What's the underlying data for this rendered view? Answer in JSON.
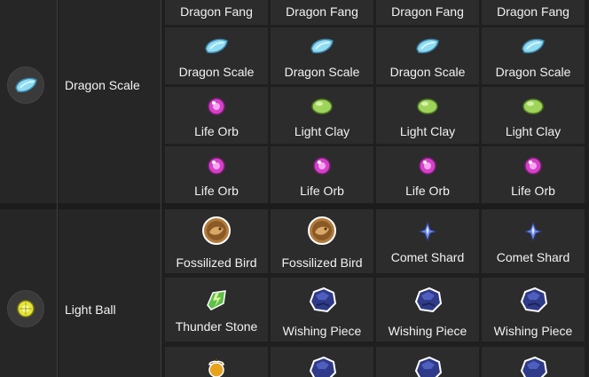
{
  "groups": [
    {
      "item": {
        "name": "Dragon Scale",
        "icon": "dragon-scale-icon"
      },
      "rows": [
        [
          "Dragon Fang",
          "Dragon Fang",
          "Dragon Fang",
          "Dragon Fang"
        ],
        [
          "Dragon Scale",
          "Dragon Scale",
          "Dragon Scale",
          "Dragon Scale"
        ],
        [
          "Life Orb",
          "Light Clay",
          "Light Clay",
          "Light Clay"
        ],
        [
          "Life Orb",
          "Life Orb",
          "Life Orb",
          "Life Orb"
        ]
      ]
    },
    {
      "item": {
        "name": "Light Ball",
        "icon": "light-ball-icon"
      },
      "rows": [
        [
          "Fossilized Bird",
          "Fossilized Bird",
          "Comet Shard",
          "Comet Shard"
        ],
        [
          "Thunder Stone",
          "Wishing Piece",
          "Wishing Piece",
          "Wishing Piece"
        ],
        [
          "",
          "",
          "",
          ""
        ]
      ]
    }
  ]
}
